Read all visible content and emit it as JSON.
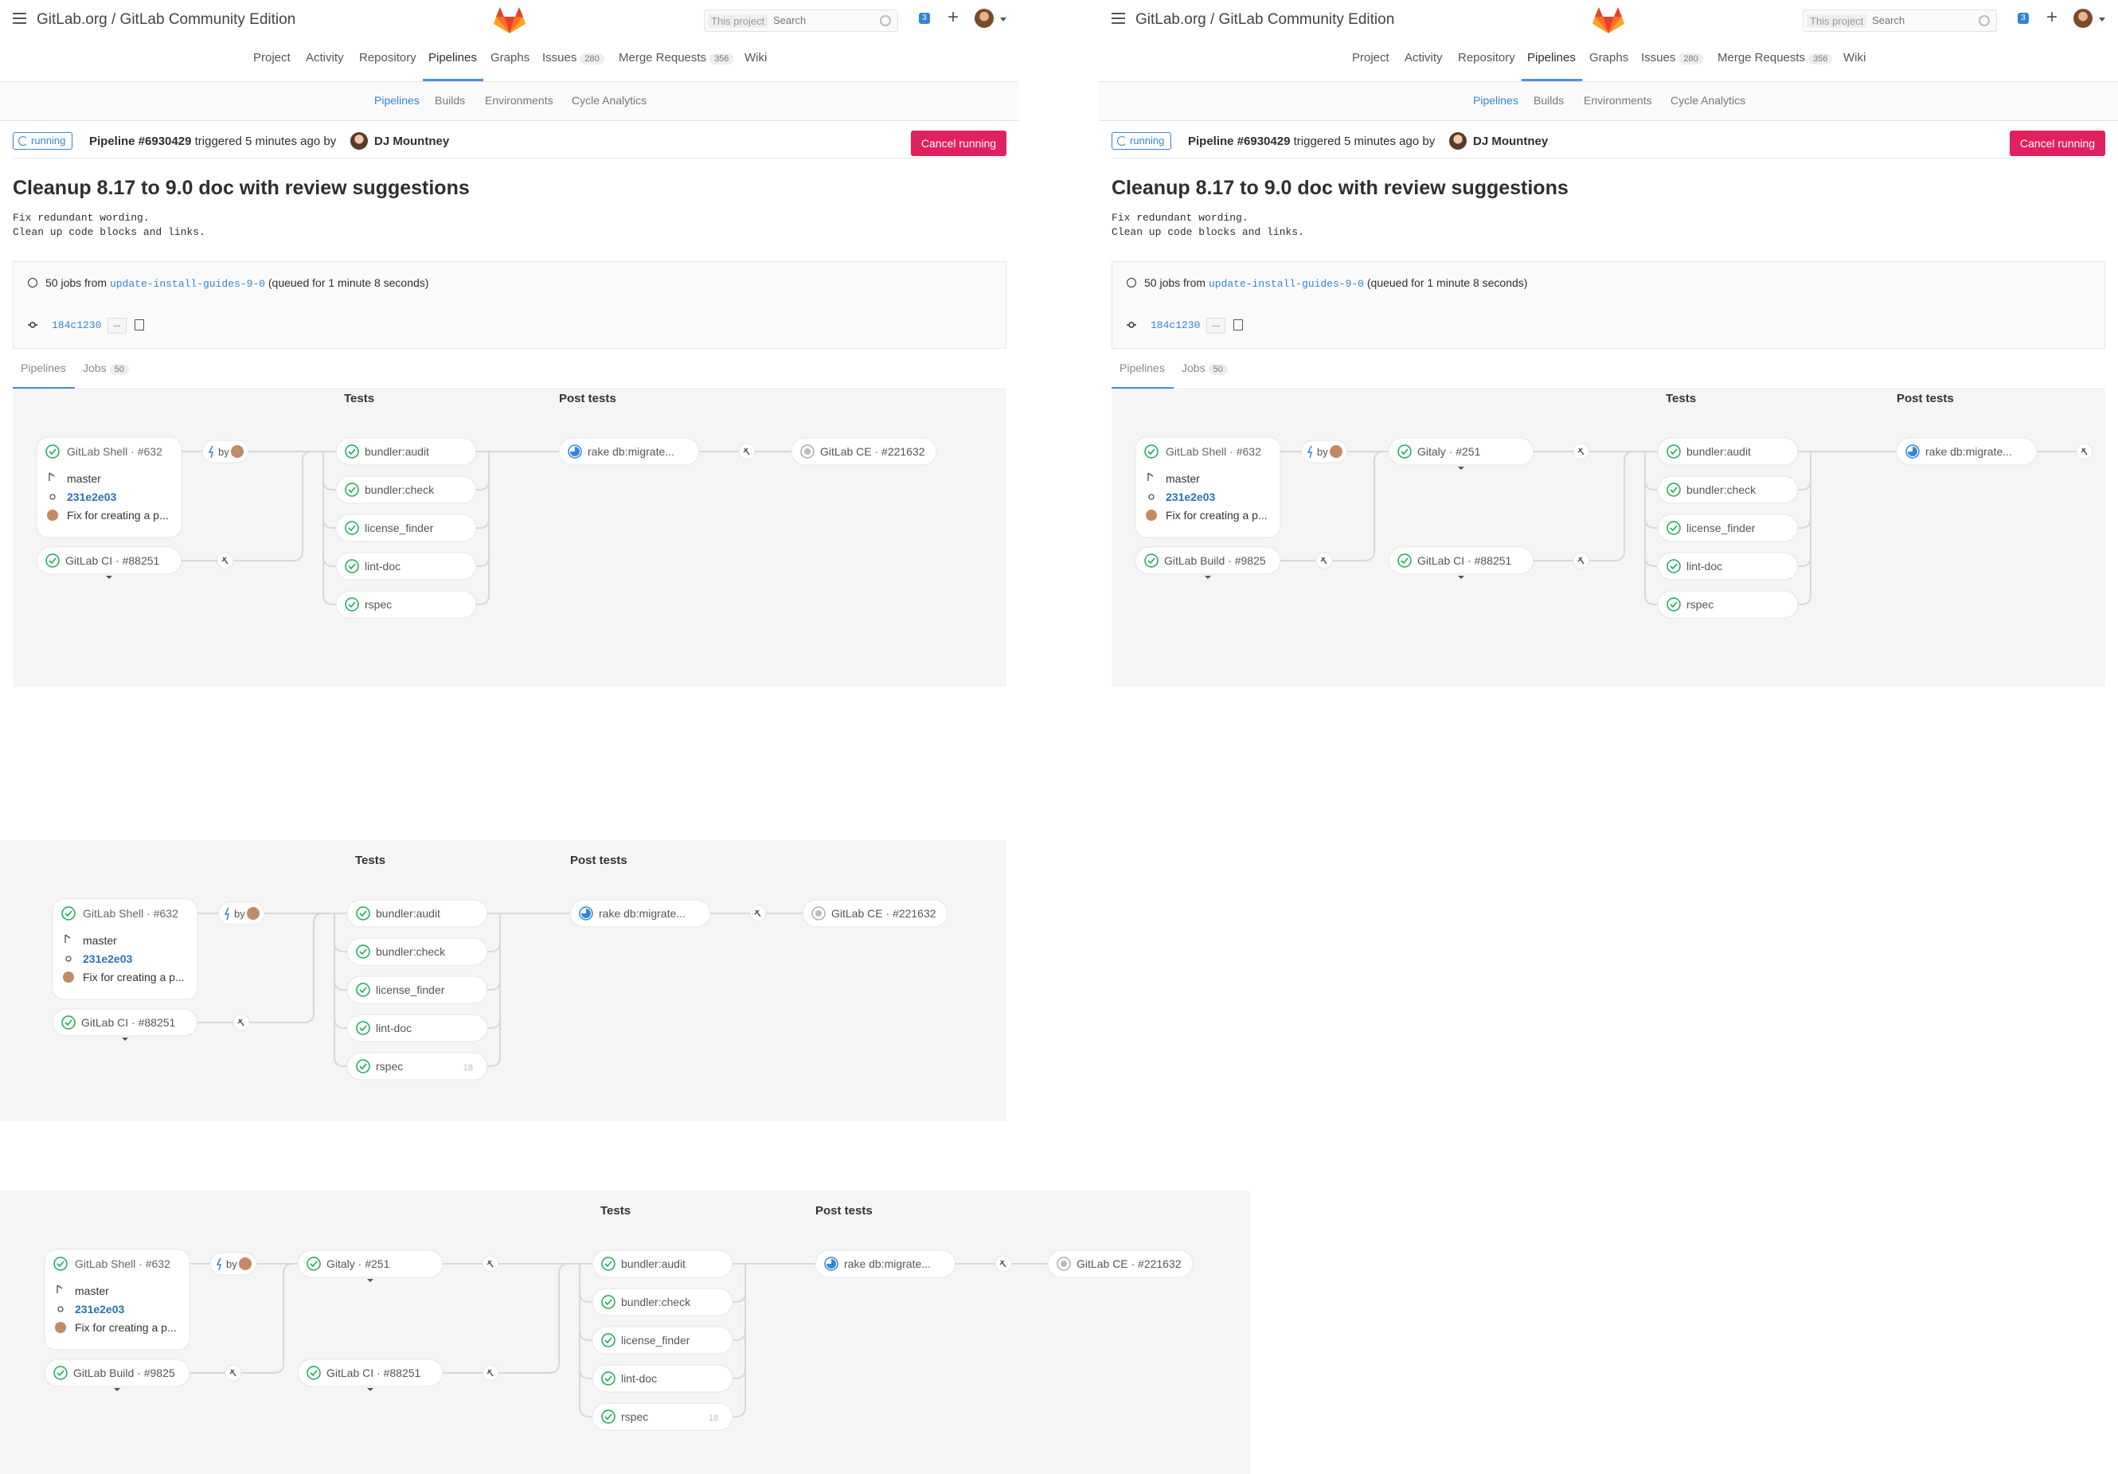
{
  "header": {
    "title": "GitLab.org / GitLab Community Edition",
    "search_scope": "This project",
    "search_placeholder": "Search",
    "todo_count": "3"
  },
  "mainnav": [
    {
      "label": "Project",
      "count": ""
    },
    {
      "label": "Activity",
      "count": ""
    },
    {
      "label": "Repository",
      "count": ""
    },
    {
      "label": "Pipelines",
      "count": "",
      "active": true
    },
    {
      "label": "Graphs",
      "count": ""
    },
    {
      "label": "Issues",
      "count": "280"
    },
    {
      "label": "Merge Requests",
      "count": "356"
    },
    {
      "label": "Wiki",
      "count": ""
    }
  ],
  "subnav": [
    {
      "label": "Pipelines",
      "active": true
    },
    {
      "label": "Builds"
    },
    {
      "label": "Environments"
    },
    {
      "label": "Cycle Analytics"
    }
  ],
  "pipeline": {
    "status": "running",
    "name": "Pipeline #6930429",
    "triggered_text": "triggered 5 minutes ago by",
    "author": "DJ Mountney",
    "cancel_label": "Cancel running"
  },
  "commit": {
    "title": "Cleanup 8.17 to 9.0 doc with review suggestions",
    "description": "Fix redundant wording.\nClean up code blocks and links.",
    "jobs_prefix": "50 jobs from",
    "branch": "update-install-guides-9-0",
    "queued": "(queued for 1 minute 8 seconds)",
    "sha": "184c1230",
    "ellipsis": "..."
  },
  "tabs": [
    {
      "label": "Pipelines",
      "count": ""
    },
    {
      "label": "Jobs",
      "count": "50"
    }
  ],
  "graph": {
    "stage_tests": "Tests",
    "stage_post": "Post tests",
    "upstream_shell": "GitLab Shell · #632",
    "branch": "master",
    "upstream_sha": "231e2e03",
    "upstream_msg": "Fix for creating a p...",
    "by_label": "by",
    "ci": "GitLab CI · #88251",
    "gitaly": "Gitaly · #251",
    "build": "GitLab Build · #9825",
    "jobs": [
      "bundler:audit",
      "bundler:check",
      "license_finder",
      "lint-doc",
      "rspec"
    ],
    "rspec_count": "18",
    "post_job": "rake db:migrate...",
    "downstream": "GitLab CE · #221632"
  },
  "colors": {
    "accent": "#3584d7",
    "danger": "#e0215d",
    "success": "#1aaa55"
  }
}
